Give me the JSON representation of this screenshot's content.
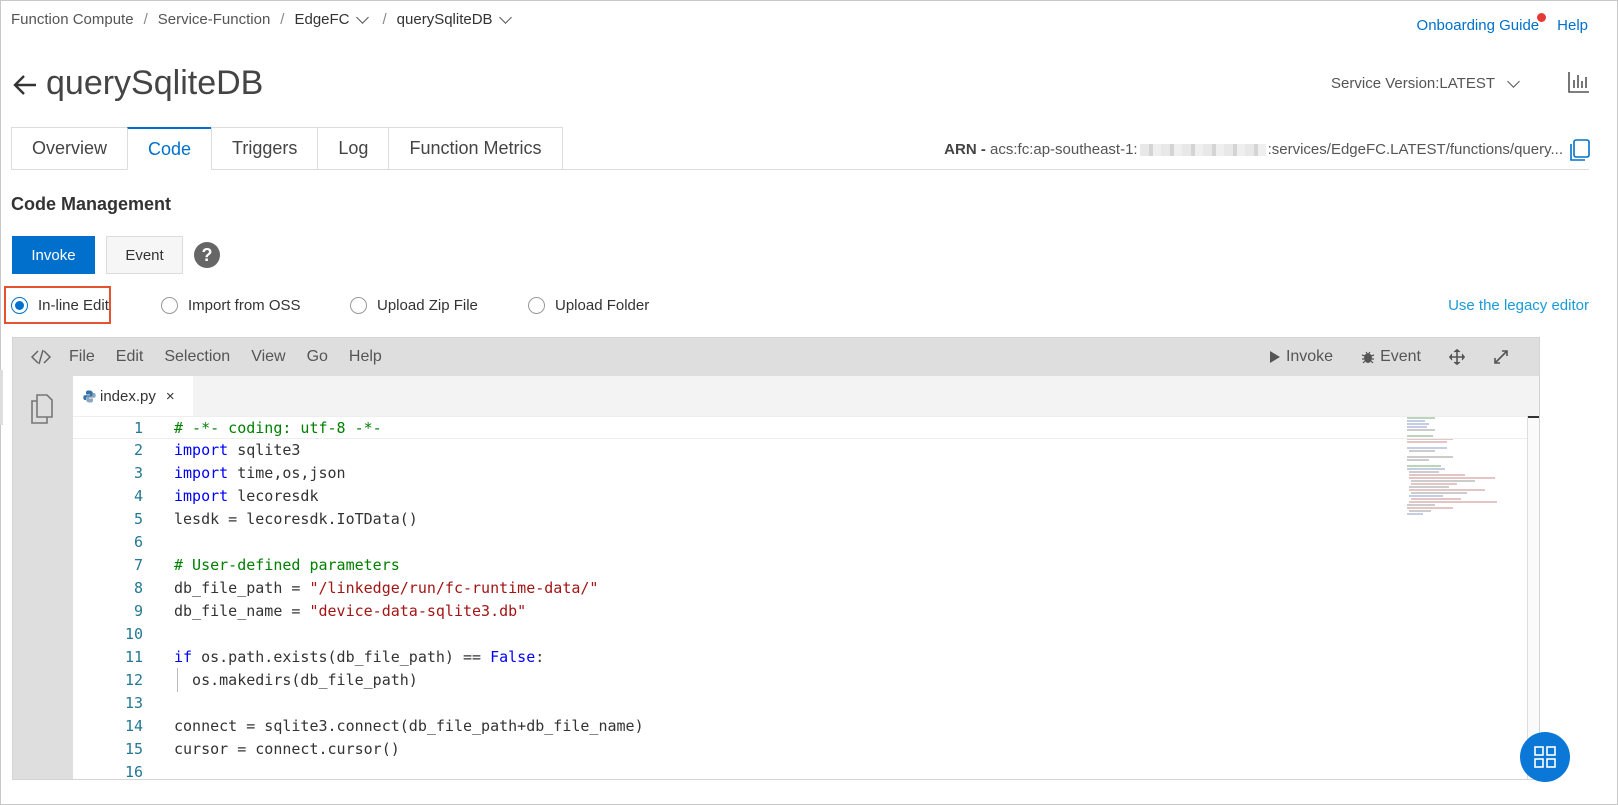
{
  "breadcrumb": {
    "items": [
      "Function Compute",
      "Service-Function",
      "EdgeFC",
      "querySqliteDB"
    ],
    "separator": "/"
  },
  "header_links": {
    "onboarding": "Onboarding Guide",
    "help": "Help"
  },
  "page": {
    "title": "querySqliteDB",
    "service_version": "Service Version:LATEST"
  },
  "tabs": [
    "Overview",
    "Code",
    "Triggers",
    "Log",
    "Function Metrics"
  ],
  "active_tab": "Code",
  "arn": {
    "label": "ARN -",
    "prefix": "acs:fc:ap-southeast-1:",
    "suffix": ":services/EdgeFC.LATEST/functions/query..."
  },
  "code_management": {
    "title": "Code Management",
    "invoke_label": "Invoke",
    "event_label": "Event",
    "help_glyph": "?"
  },
  "source_options": {
    "options": [
      "In-line Edit",
      "Import from OSS",
      "Upload Zip File",
      "Upload Folder"
    ],
    "selected": "In-line Edit",
    "legacy_link": "Use the legacy editor"
  },
  "editor": {
    "menu": [
      "File",
      "Edit",
      "Selection",
      "View",
      "Go",
      "Help"
    ],
    "toolbar": {
      "invoke": "Invoke",
      "event": "Event"
    },
    "open_file": "index.py",
    "close_glyph": "×",
    "lines": [
      {
        "n": "1",
        "tokens": [
          {
            "t": "# -*- coding: utf-8 -*-",
            "c": "cm"
          }
        ]
      },
      {
        "n": "2",
        "tokens": [
          {
            "t": "import",
            "c": "kw"
          },
          {
            "t": " sqlite3",
            "c": ""
          }
        ]
      },
      {
        "n": "3",
        "tokens": [
          {
            "t": "import",
            "c": "kw"
          },
          {
            "t": " time,os,json",
            "c": ""
          }
        ]
      },
      {
        "n": "4",
        "tokens": [
          {
            "t": "import",
            "c": "kw"
          },
          {
            "t": " lecoresdk",
            "c": ""
          }
        ]
      },
      {
        "n": "5",
        "tokens": [
          {
            "t": "lesdk = lecoresdk.IoTData()",
            "c": ""
          }
        ]
      },
      {
        "n": "6",
        "tokens": []
      },
      {
        "n": "7",
        "tokens": [
          {
            "t": "# User-defined parameters",
            "c": "cm"
          }
        ]
      },
      {
        "n": "8",
        "tokens": [
          {
            "t": "db_file_path = ",
            "c": ""
          },
          {
            "t": "\"/linkedge/run/fc-runtime-data/\"",
            "c": "st"
          }
        ]
      },
      {
        "n": "9",
        "tokens": [
          {
            "t": "db_file_name = ",
            "c": ""
          },
          {
            "t": "\"device-data-sqlite3.db\"",
            "c": "st"
          }
        ]
      },
      {
        "n": "10",
        "tokens": []
      },
      {
        "n": "11",
        "tokens": [
          {
            "t": "if",
            "c": "kw"
          },
          {
            "t": " os.path.exists(db_file_path) == ",
            "c": ""
          },
          {
            "t": "False",
            "c": "kw"
          },
          {
            "t": ":",
            "c": ""
          }
        ]
      },
      {
        "n": "12",
        "tokens": [
          {
            "t": "  os.makedirs(db_file_path)",
            "c": ""
          }
        ]
      },
      {
        "n": "13",
        "tokens": []
      },
      {
        "n": "14",
        "tokens": [
          {
            "t": "connect = sqlite3.connect(db_file_path+db_file_name)",
            "c": ""
          }
        ]
      },
      {
        "n": "15",
        "tokens": [
          {
            "t": "cursor = connect.cursor()",
            "c": ""
          }
        ]
      },
      {
        "n": "16",
        "tokens": []
      }
    ]
  },
  "colors": {
    "primary": "#0070cc",
    "link": "#1a9bd7",
    "highlight_border": "#e5532e",
    "keyword": "#0000ff",
    "comment": "#008000",
    "string": "#a31515",
    "line_number": "#237893"
  }
}
